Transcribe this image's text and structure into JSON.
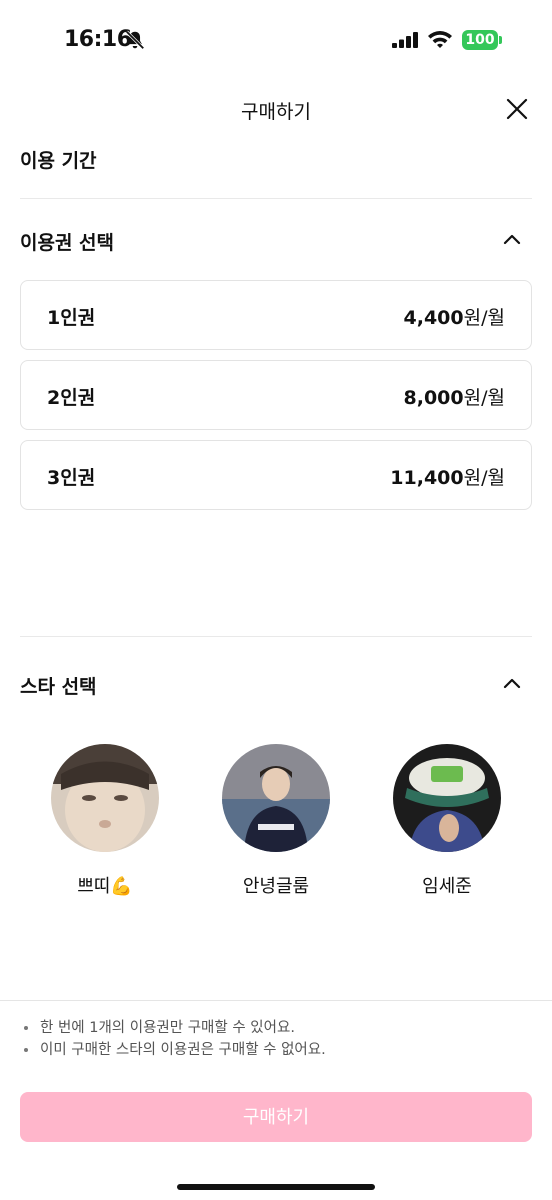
{
  "status_bar": {
    "time": "16:16",
    "battery": "100"
  },
  "header": {
    "title": "구매하기"
  },
  "usage_period": {
    "label": "이용 기간"
  },
  "ticket_section": {
    "title": "이용권 선택",
    "plans": [
      {
        "name": "1인권",
        "amount": "4,400",
        "unit": "원/월"
      },
      {
        "name": "2인권",
        "amount": "8,000",
        "unit": "원/월"
      },
      {
        "name": "3인권",
        "amount": "11,400",
        "unit": "원/월"
      }
    ]
  },
  "star_section": {
    "title": "스타 선택",
    "stars": [
      {
        "name": "쁘띠💪"
      },
      {
        "name": "안녕글룸"
      },
      {
        "name": "임세준"
      }
    ]
  },
  "notices": [
    "한 번에 1개의 이용권만 구매할 수 있어요.",
    "이미 구매한 스타의 이용권은 구매할 수 없어요."
  ],
  "buy_button": {
    "label": "구매하기"
  },
  "colors": {
    "accent_disabled": "#ffb6cb",
    "battery": "#34c759"
  }
}
